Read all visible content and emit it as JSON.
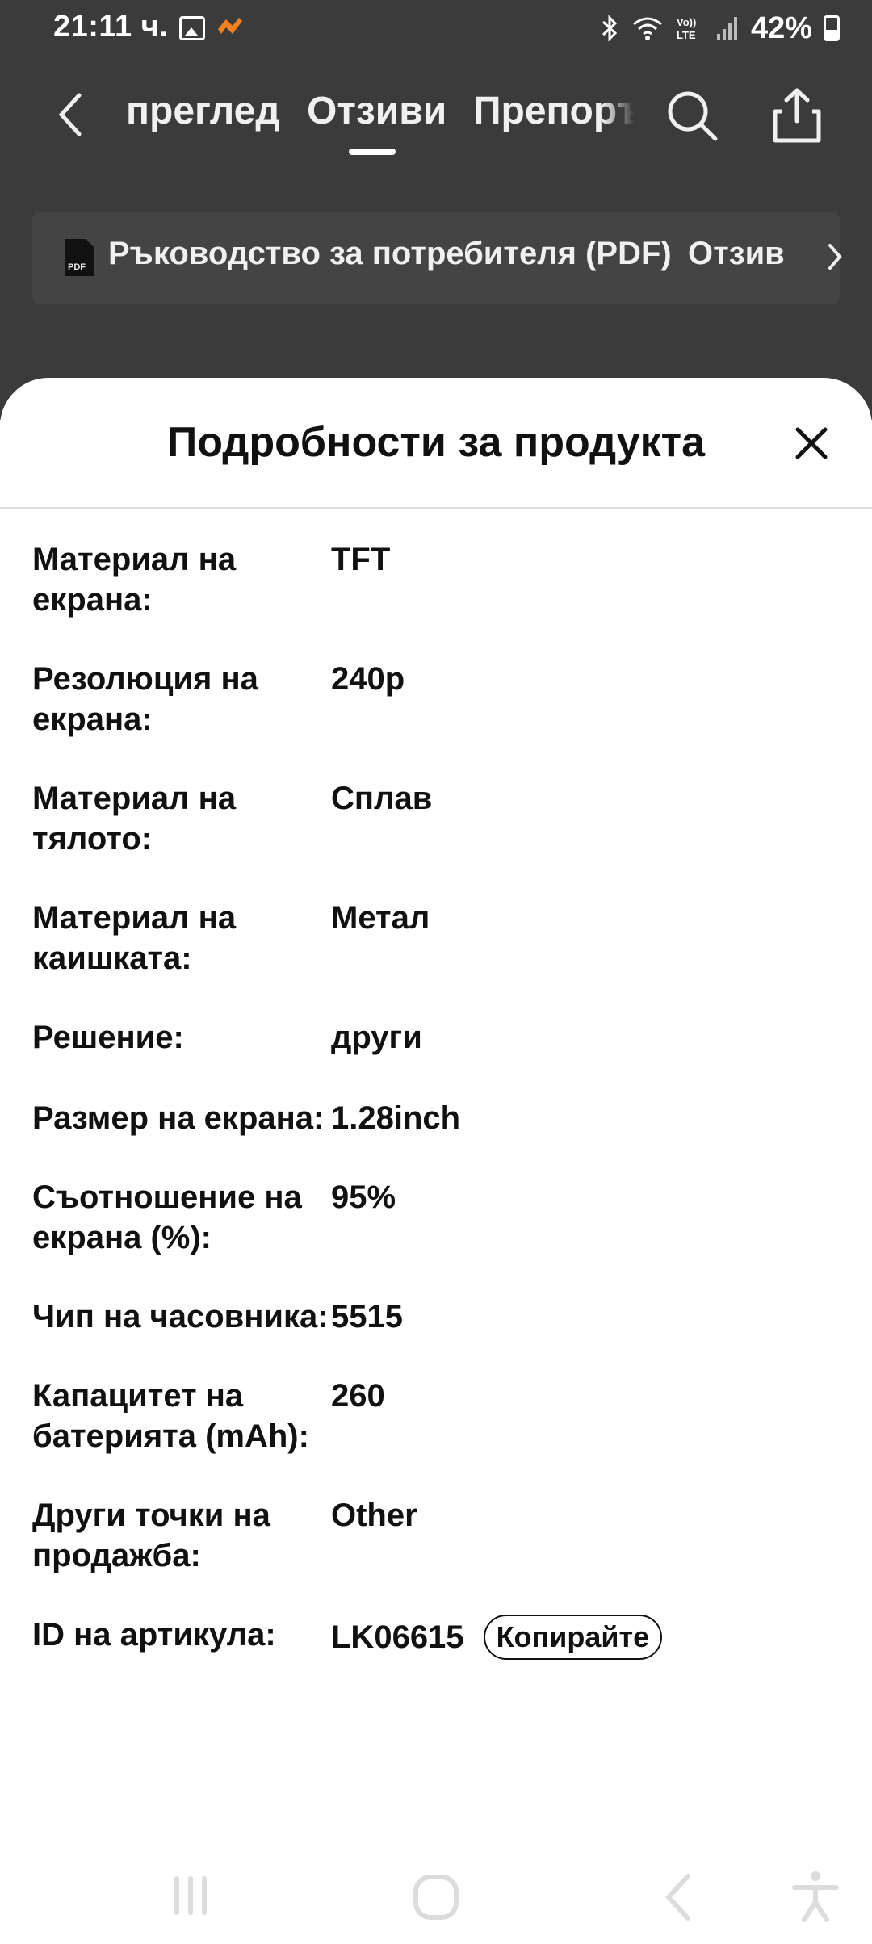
{
  "status_bar": {
    "time": "21:11 ч.",
    "battery": "42%",
    "icons": [
      "gallery-icon",
      "app-notification-icon",
      "bluetooth-icon",
      "wifi-icon",
      "volte-icon",
      "signal-icon",
      "battery-icon"
    ]
  },
  "top_nav": {
    "tabs": [
      {
        "label": "преглед"
      },
      {
        "label": "Отзиви"
      },
      {
        "label": "Препоръчани"
      }
    ],
    "active_tab": "Отзиви"
  },
  "manual_row": {
    "label": "Ръководство за потребителя (PDF)",
    "review": "Отзив"
  },
  "sheet": {
    "title": "Подробности за продукта",
    "rows": [
      {
        "label": "Материал на екрана:",
        "value": "TFT"
      },
      {
        "label": "Резолюция на екрана:",
        "value": "240p"
      },
      {
        "label": "Материал на тялото:",
        "value": "Сплав"
      },
      {
        "label": "Материал на каишката:",
        "value": "Метал"
      },
      {
        "label": "Решение:",
        "value": "други"
      },
      {
        "label": "Размер на екрана:",
        "value": "1.28inch"
      },
      {
        "label": "Съотношение на екрана (%):",
        "value": "95%"
      },
      {
        "label": "Чип на часовника:",
        "value": "5515"
      },
      {
        "label": "Капацитет на батерията (mAh):",
        "value": "260"
      },
      {
        "label": "Други точки на продажба:",
        "value": "Other"
      },
      {
        "label": "ID на артикула:",
        "value": "LK06615"
      }
    ],
    "copy_label": "Копирайте"
  },
  "colors": {
    "dim_background": "#3b3b3b",
    "sheet_background": "#ffffff",
    "text": "#111111",
    "accent_app_icon": "#f5821f"
  }
}
